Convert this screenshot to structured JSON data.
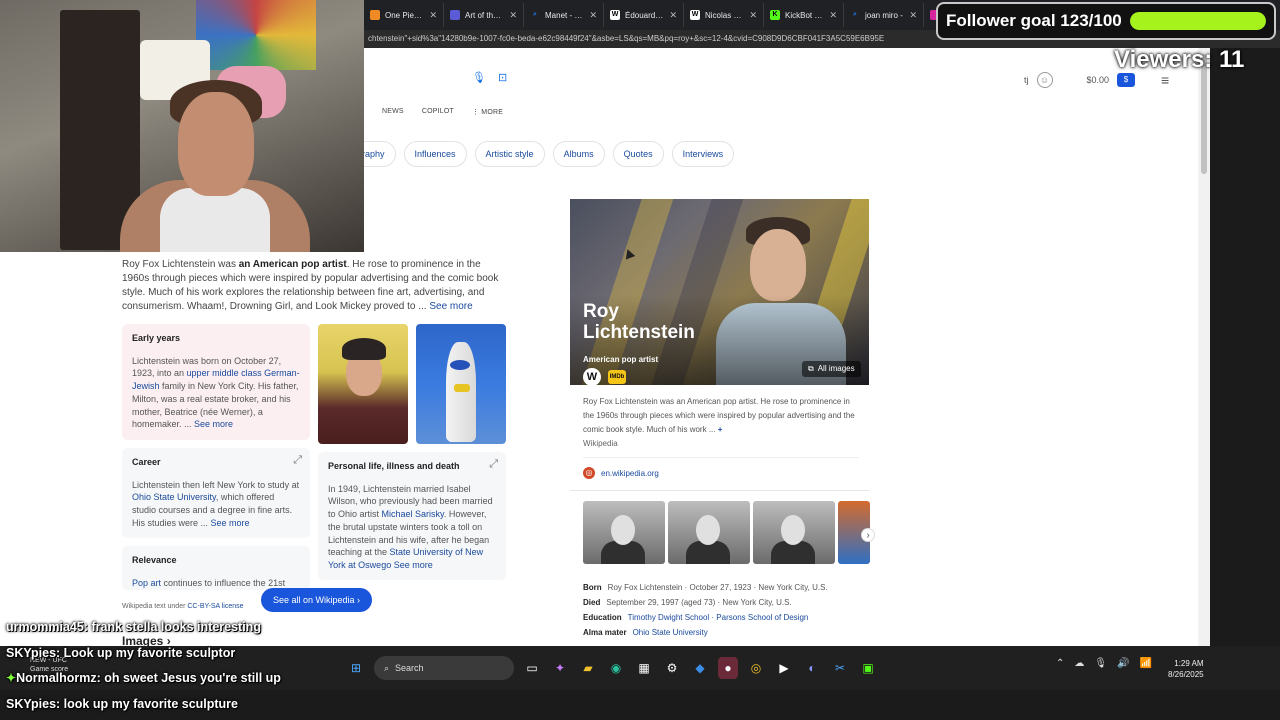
{
  "browser": {
    "tabs": [
      {
        "label": "One Piece: V",
        "color": "#f08a24"
      },
      {
        "label": "Art of the V",
        "color": "#5b5bd6"
      },
      {
        "label": "Manet - Sea",
        "color": "#1a73e8"
      },
      {
        "label": "Édouard Ma",
        "color": "#ffffff"
      },
      {
        "label": "Nicolas Pou",
        "color": "#ffffff"
      },
      {
        "label": "KickBot Das",
        "color": "#53fc18"
      },
      {
        "label": "joan miro -",
        "color": "#1a73e8"
      }
    ],
    "address": "chtenstein\"+sid%3a\"14280b9e-1007-fc0e-beda-e62c98449f24\"&asbe=LS&qs=MB&pq=roy+&sc=12-4&cvid=C908D9D6CBF041F3A5C59E6B95E"
  },
  "header": {
    "user_initial": "tj",
    "balance": "$0.00",
    "dollar_symbol": "$"
  },
  "nav_tabs": [
    "NEWS",
    "COPILOT",
    "⋮ MORE"
  ],
  "chips": [
    "raphy",
    "Influences",
    "Artistic style",
    "Albums",
    "Quotes",
    "Interviews"
  ],
  "intro": {
    "pre": "Roy Fox Lichtenstein was ",
    "bold": "an American pop artist",
    "post": ". He rose to prominence in the 1960s through pieces which were inspired by popular advertising and the comic book style. Much of his work explores the relationship between fine art, advertising, and consumerism. Whaam!, Drowning Girl, and Look Mickey proved to ... ",
    "see_more": "See more"
  },
  "cards": {
    "early_years": {
      "title": "Early years",
      "t1": "Lichtenstein was born on October 27, 1923, into an ",
      "link": "upper middle class German-Jewish",
      "t2": " family in New York City. His father, Milton, was a real estate broker, and his mother, Beatrice (née Werner), a homemaker. ... ",
      "see_more": "See more"
    },
    "career": {
      "title": "Career",
      "t1": "Lichtenstein then left New York to study at ",
      "link": "Ohio State University",
      "t2": ", which offered studio courses and a degree in fine arts. His studies were ... ",
      "see_more": "See more"
    },
    "personal": {
      "title": "Personal life, illness and death",
      "t1": "In 1949, Lichtenstein married Isabel Wilson, who previously had been married to Ohio artist ",
      "link1": "Michael Sarisky",
      "t2": ". However, the brutal upstate winters took a toll on Lichtenstein and his wife, after he began teaching at the ",
      "link2": "State University of New York at Oswego",
      "see_more": " See more"
    },
    "relevance": {
      "title": "Relevance",
      "link": "Pop art",
      "t1": " continues to influence the 21st"
    }
  },
  "wiki_note": {
    "text": "Wikipedia text under ",
    "link": "CC-BY-SA license"
  },
  "wiki_button": "See all on Wikipedia  ›",
  "knowledge_panel": {
    "title": "Roy Lichtenstein",
    "subtitle": "American pop artist",
    "source_w": "W",
    "source_imdb": "IMDb",
    "all_images": "All images",
    "description": "Roy Fox Lichtenstein was an American pop artist. He rose to prominence in the 1960s through pieces which were inspired by popular advertising and the comic book style. Much of his work ... ",
    "plus": "+",
    "desc_source": "Wikipedia",
    "link": "en.wikipedia.org",
    "facts": {
      "born_label": "Born",
      "born_value": "Roy Fox Lichtenstein · October 27, 1923 · New York City, U.S.",
      "died_label": "Died",
      "died_value": "September 29, 1997 (aged 73) · New York City, U.S.",
      "education_label": "Education",
      "education_value": "Timothy Dwight School · Parsons School of Design",
      "alma_label": "Alma mater",
      "alma_value": "Ohio State University"
    }
  },
  "overlay": {
    "follower_goal": "Follower goal 123/100",
    "goal_fill_percent": 100,
    "viewers": "Viewers: 11"
  },
  "chat": [
    {
      "user": "urmommia45:",
      "msg": " frank stella looks interesting"
    },
    {
      "user": "SKYpies:",
      "msg": " Look up my favorite sculptor"
    },
    {
      "user": "Normalhormz:",
      "msg": " oh sweet Jesus you're still up"
    },
    {
      "user": "SKYpies:",
      "msg": " look up my favorite sculpture"
    }
  ],
  "images_label": "Images ›",
  "taskbar": {
    "weather_line1": "NEW - UFC",
    "weather_line2": "Game score",
    "search": "Search",
    "time": "1:29 AM",
    "date": "8/26/2025"
  }
}
